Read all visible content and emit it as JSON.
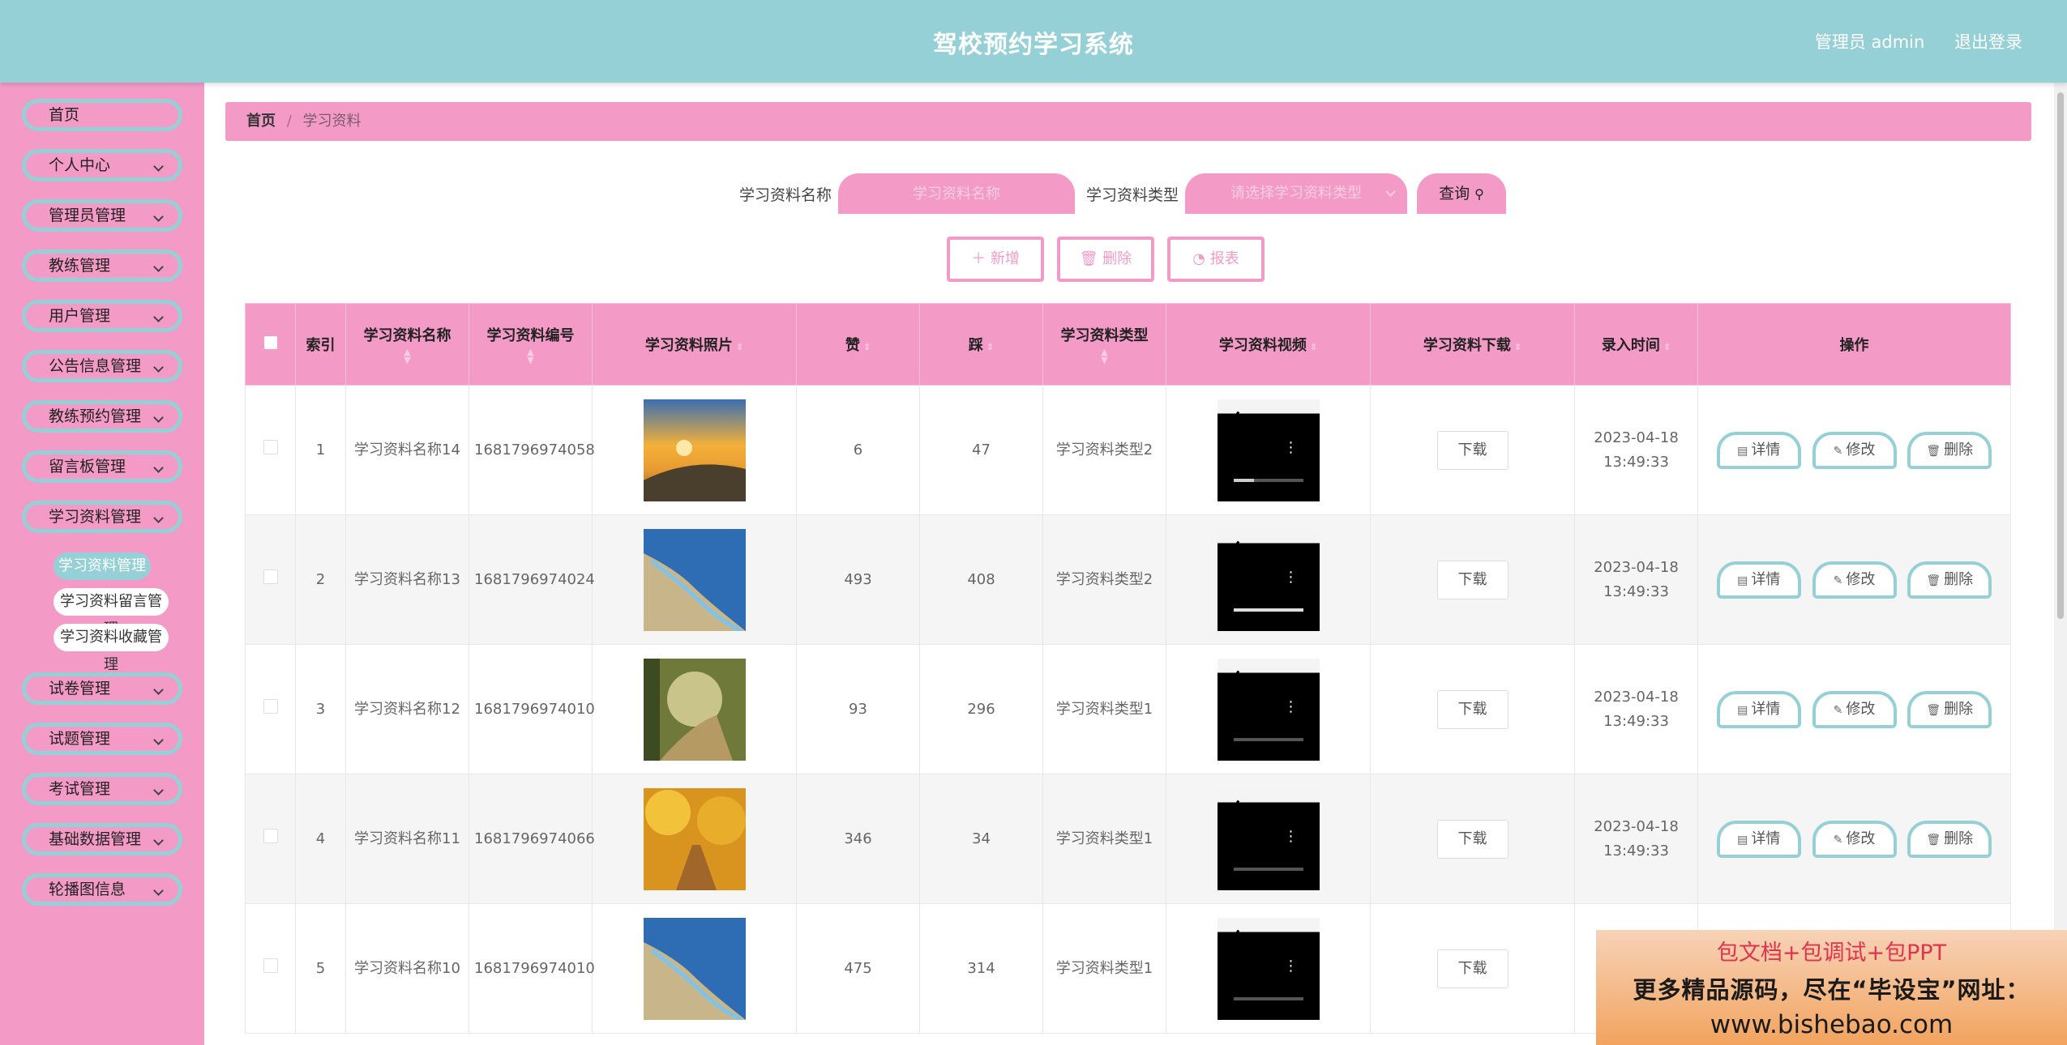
{
  "header": {
    "title": "驾校预约学习系统",
    "user": "管理员 admin",
    "logout": "退出登录"
  },
  "sidebar": {
    "items": [
      {
        "label": "首页",
        "has_arrow": false
      },
      {
        "label": "个人中心",
        "has_arrow": true
      },
      {
        "label": "管理员管理",
        "has_arrow": true
      },
      {
        "label": "教练管理",
        "has_arrow": true
      },
      {
        "label": "用户管理",
        "has_arrow": true
      },
      {
        "label": "公告信息管理",
        "has_arrow": true
      },
      {
        "label": "教练预约管理",
        "has_arrow": true
      },
      {
        "label": "留言板管理",
        "has_arrow": true
      },
      {
        "label": "学习资料管理",
        "has_arrow": true
      },
      {
        "label": "试卷管理",
        "has_arrow": true
      },
      {
        "label": "试题管理",
        "has_arrow": true
      },
      {
        "label": "考试管理",
        "has_arrow": true
      },
      {
        "label": "基础数据管理",
        "has_arrow": true
      },
      {
        "label": "轮播图信息",
        "has_arrow": true
      }
    ],
    "subitems": [
      {
        "label": "学习资料管理",
        "active": true
      },
      {
        "label": "学习资料留言管理",
        "active": false
      },
      {
        "label": "学习资料收藏管理",
        "active": false
      }
    ]
  },
  "breadcrumb": {
    "home": "首页",
    "separator": "/",
    "current": "学习资料"
  },
  "search": {
    "name_label": "学习资料名称",
    "name_placeholder": "学习资料名称",
    "type_label": "学习资料类型",
    "type_placeholder": "请选择学习资料类型",
    "query": "查询"
  },
  "actions": {
    "add": "新增",
    "delete": "删除",
    "report": "报表"
  },
  "table": {
    "headers": [
      "索引",
      "学习资料名称",
      "学习资料编号",
      "学习资料照片",
      "赞",
      "踩",
      "学习资料类型",
      "学习资料视频",
      "学习资料下载",
      "录入时间",
      "操作"
    ],
    "rows": [
      {
        "index": "1",
        "name": "学习资料名称14",
        "code": "1681796974058",
        "likes": "6",
        "dislikes": "47",
        "type": "学习资料类型2",
        "time": "2023-04-18 13:49:33"
      },
      {
        "index": "2",
        "name": "学习资料名称13",
        "code": "1681796974024",
        "likes": "493",
        "dislikes": "408",
        "type": "学习资料类型2",
        "time": "2023-04-18 13:49:33"
      },
      {
        "index": "3",
        "name": "学习资料名称12",
        "code": "1681796974010",
        "likes": "93",
        "dislikes": "296",
        "type": "学习资料类型1",
        "time": "2023-04-18 13:49:33"
      },
      {
        "index": "4",
        "name": "学习资料名称11",
        "code": "1681796974066",
        "likes": "346",
        "dislikes": "34",
        "type": "学习资料类型1",
        "time": "2023-04-18 13:49:33"
      },
      {
        "index": "5",
        "name": "学习资料名称10",
        "code": "1681796974010",
        "likes": "475",
        "dislikes": "314",
        "type": "学习资料类型1",
        "time": ""
      }
    ],
    "download_label": "下载",
    "op_detail": "详情",
    "op_edit": "修改",
    "op_delete": "删除"
  },
  "watermark": {
    "line1": "包文档+包调试+包PPT",
    "line2": "更多精品源码，尽在“毕设宝”网址：",
    "line3": "www.bishebao.com"
  },
  "colors": {
    "header": "#96d0d7",
    "accent": "#f39bc6"
  }
}
